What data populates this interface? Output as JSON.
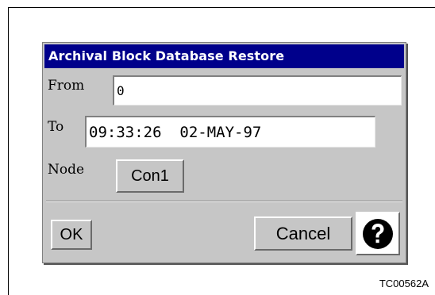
{
  "dialog": {
    "title": "Archival Block Database Restore",
    "from_label": "From",
    "from_value": "0",
    "to_label": "To",
    "to_value": "09:33:26  02-MAY-97",
    "node_label": "Node",
    "node_button": "Con1",
    "ok_label": "OK",
    "cancel_label": "Cancel",
    "help_icon": "question-mark-icon"
  },
  "figure_id": "TC00562A",
  "colors": {
    "titlebar": "#00008b",
    "dialog_bg": "#c6c6c6"
  }
}
